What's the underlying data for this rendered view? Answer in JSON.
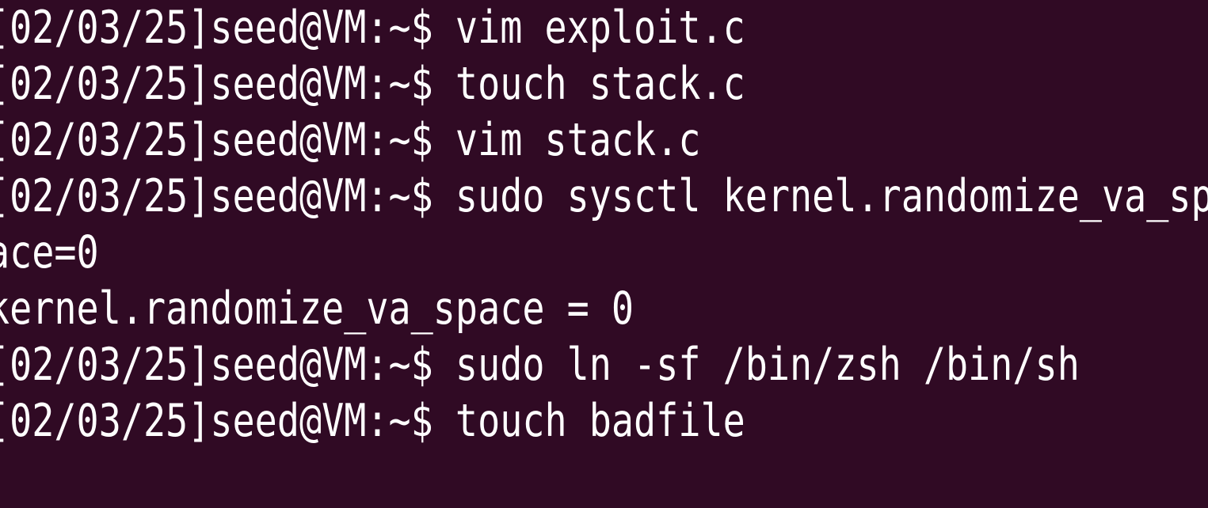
{
  "terminal": {
    "background_color": "#300a24",
    "text_color": "#ffffff",
    "lines": [
      "[02/03/25]seed@VM:~$ vim exploit.c",
      "[02/03/25]seed@VM:~$ touch stack.c",
      "[02/03/25]seed@VM:~$ vim stack.c",
      "[02/03/25]seed@VM:~$ sudo sysctl kernel.randomize_va_sp",
      "ace=0",
      "kernel.randomize_va_space = 0",
      "[02/03/25]seed@VM:~$ sudo ln -sf /bin/zsh /bin/sh",
      "[02/03/25]seed@VM:~$ touch badfile"
    ]
  }
}
